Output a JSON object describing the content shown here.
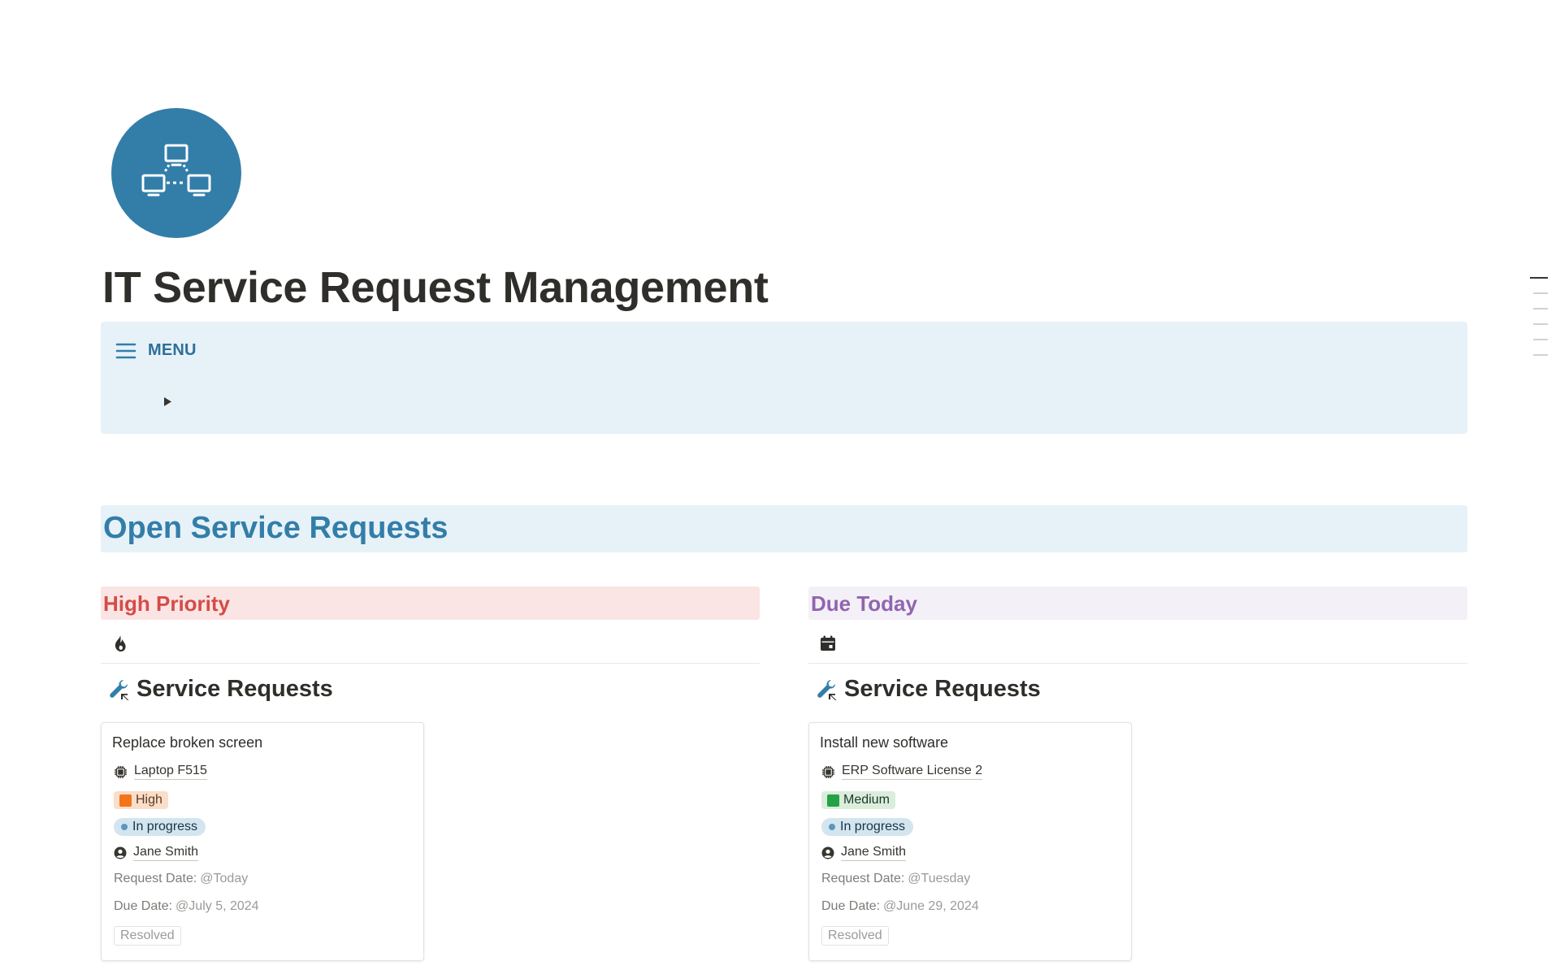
{
  "page": {
    "icon": "network-computers-icon",
    "title": "IT Service Request Management"
  },
  "menu": {
    "icon": "hamburger-menu-icon",
    "label": "MENU",
    "toggle_icon": "triangle-right-icon",
    "background": "#e7f2f8",
    "accent": "#2f6f99"
  },
  "section": {
    "title": "Open Service Requests",
    "color": "#337ea9"
  },
  "columns": [
    {
      "heading": "High Priority",
      "heading_color": "#d44c47",
      "heading_bg": "#fbe4e4",
      "icon": "fire-icon",
      "database_icon": "wrench-link-icon",
      "database_title": "Service Requests",
      "card": {
        "title": "Replace broken screen",
        "asset_icon": "chip-icon",
        "asset": "Laptop F515",
        "priority": "High",
        "priority_color": "#f2751a",
        "status": "In progress",
        "assignee_icon": "user-circle-icon",
        "assignee": "Jane Smith",
        "request_date_label": "Request Date:",
        "request_date": "@Today",
        "due_date_label": "Due Date:",
        "due_date": "@July 5, 2024",
        "resolved_label": "Resolved"
      }
    },
    {
      "heading": "Due Today",
      "heading_color": "#9065b0",
      "heading_bg": "#f4f0f7",
      "icon": "calendar-icon",
      "database_icon": "wrench-link-icon",
      "database_title": "Service Requests",
      "card": {
        "title": "Install new software",
        "asset_icon": "chip-icon",
        "asset": "ERP Software License 2",
        "priority": "Medium",
        "priority_color": "#25a244",
        "status": "In progress",
        "assignee_icon": "user-circle-icon",
        "assignee": "Jane Smith",
        "request_date_label": "Request Date:",
        "request_date": "@Tuesday",
        "due_date_label": "Due Date:",
        "due_date": "@June 29, 2024",
        "resolved_label": "Resolved"
      }
    }
  ]
}
